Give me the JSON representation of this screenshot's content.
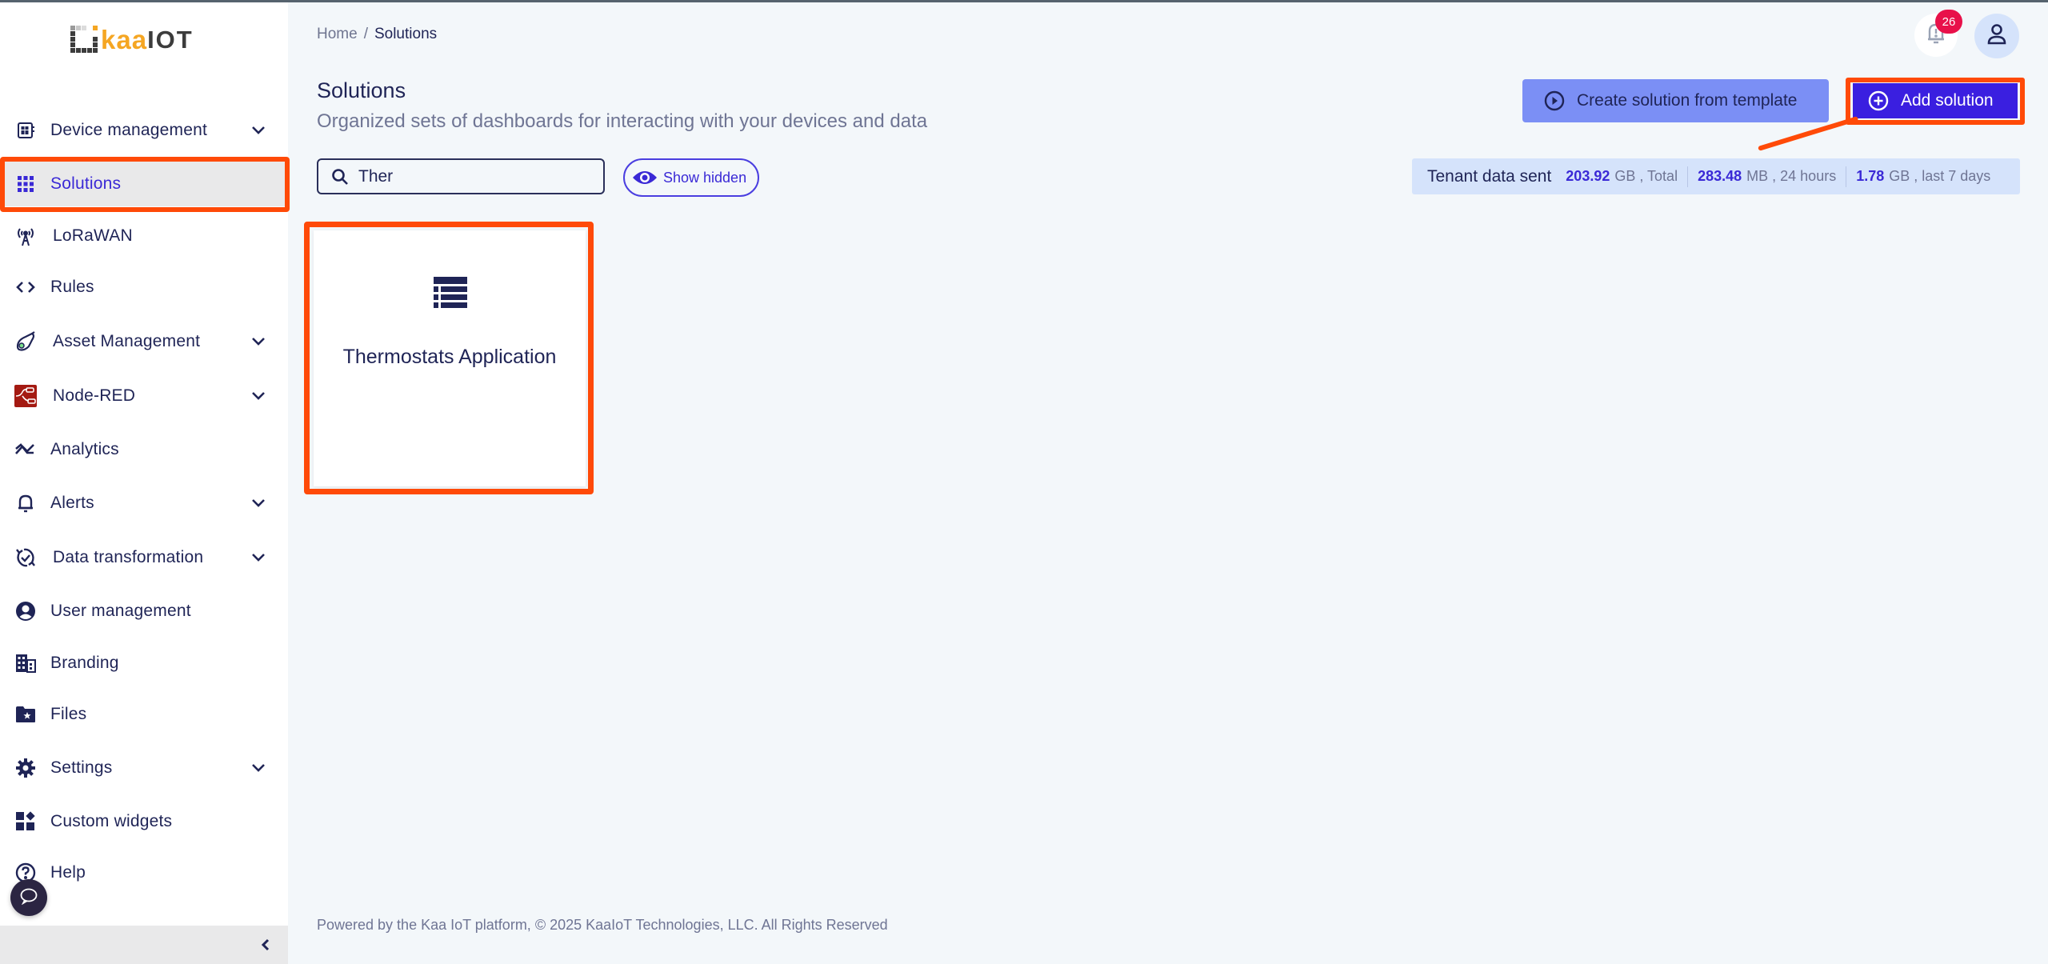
{
  "app": {
    "logo_text_kaa": "kaa",
    "logo_text_iot": "IOT"
  },
  "colors": {
    "accent": "#3a29d6",
    "highlight": "#ff4a08",
    "logo_orange": "#f5a623",
    "badge": "#e8114a"
  },
  "sidebar": {
    "items": [
      {
        "label": "Device management",
        "icon": "device-icon",
        "expandable": true
      },
      {
        "label": "Solutions",
        "icon": "grid-icon",
        "expandable": false,
        "active": true
      },
      {
        "label": "LoRaWAN",
        "icon": "antenna-icon",
        "expandable": false
      },
      {
        "label": "Rules",
        "icon": "code-icon",
        "expandable": false
      },
      {
        "label": "Asset Management",
        "icon": "asset-tag-icon",
        "expandable": true
      },
      {
        "label": "Node-RED",
        "icon": "node-red-icon",
        "expandable": true
      },
      {
        "label": "Analytics",
        "icon": "analytics-icon",
        "expandable": false
      },
      {
        "label": "Alerts",
        "icon": "bell-icon",
        "expandable": true
      },
      {
        "label": "Data transformation",
        "icon": "sync-check-icon",
        "expandable": true
      },
      {
        "label": "User management",
        "icon": "user-circle-icon",
        "expandable": false
      },
      {
        "label": "Branding",
        "icon": "building-icon",
        "expandable": false
      },
      {
        "label": "Files",
        "icon": "folder-star-icon",
        "expandable": false
      },
      {
        "label": "Settings",
        "icon": "gear-icon",
        "expandable": true
      },
      {
        "label": "Custom widgets",
        "icon": "widgets-icon",
        "expandable": false
      },
      {
        "label": "Help",
        "icon": "help-icon",
        "expandable": false
      }
    ]
  },
  "header": {
    "breadcrumb": {
      "home": "Home",
      "separator": "/",
      "current": "Solutions"
    },
    "notifications_count": "26"
  },
  "main": {
    "title": "Solutions",
    "subtitle": "Organized sets of dashboards for interacting with your devices and data",
    "search": {
      "value": "Ther",
      "placeholder": ""
    },
    "show_hidden_label": "Show hidden",
    "create_template_label": "Create solution from template",
    "add_solution_label": "Add solution",
    "tenant": {
      "label": "Tenant data sent",
      "stats": [
        {
          "value": "203.92",
          "unit": "GB , Total"
        },
        {
          "value": "283.48",
          "unit": "MB , 24 hours"
        },
        {
          "value": "1.78",
          "unit": "GB , last 7 days"
        }
      ]
    },
    "solutions": [
      {
        "name": "Thermostats Application",
        "icon": "list-icon"
      }
    ]
  },
  "footer": {
    "text": "Powered by the Kaa IoT platform, © 2025 KaaIoT Technologies, LLC. All Rights Reserved"
  }
}
